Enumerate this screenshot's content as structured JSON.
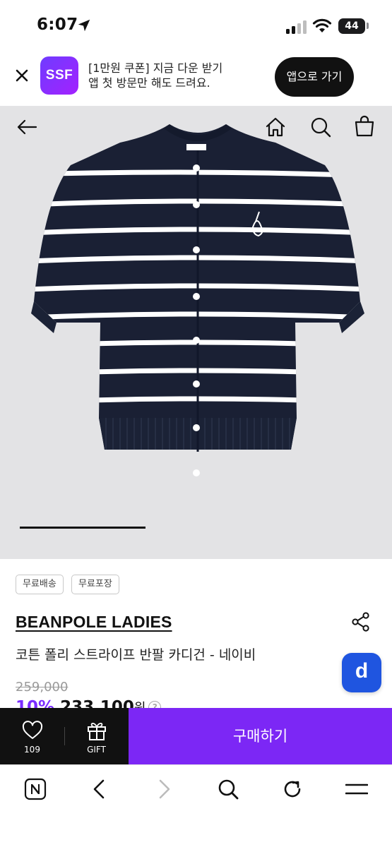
{
  "status_bar": {
    "time": "6:07",
    "battery": "44"
  },
  "app_banner": {
    "logo_text": "SSF",
    "message_line1": "[1만원 쿠폰] 지금 다운 받기",
    "message_line2": "앱 첫 방문만 해도 드려요.",
    "open_app_label": "앱으로 가기"
  },
  "product": {
    "tags": [
      "무료배송",
      "무료포장"
    ],
    "brand": "BEANPOLE LADIES",
    "name": "코튼 폴리 스트라이프 반팔 카디건 - 네이비",
    "original_price": "259,000",
    "discount": "10%",
    "sale_price": "233,100",
    "price_unit": "원",
    "help_mark": "?",
    "floating_button_label": "d"
  },
  "image_carousel": {
    "progress": 0.33
  },
  "purchase_bar": {
    "like_count": "109",
    "gift_label": "GIFT",
    "buy_label": "구매하기"
  },
  "colors": {
    "brand_purple": "#7c27f5",
    "dark_bar": "#111111",
    "d_button_blue": "#1f55e0",
    "navy": "#1a2034"
  },
  "icons": {
    "hero": [
      "back-arrow-icon",
      "home-icon",
      "search-icon",
      "shopping-bag-icon"
    ],
    "browser": [
      "naver-icon",
      "back-icon",
      "forward-icon",
      "search-icon",
      "reload-icon",
      "menu-icon"
    ]
  }
}
